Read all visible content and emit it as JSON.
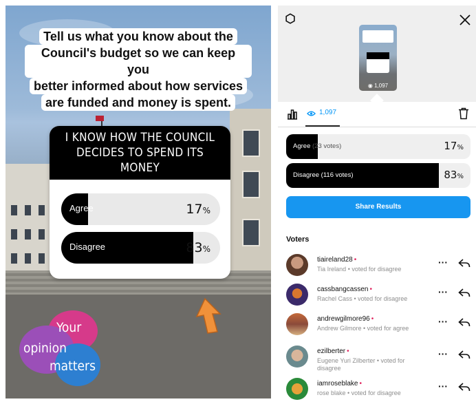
{
  "story": {
    "question_lines": [
      "Tell us what you know about the",
      "Council's budget so we can keep you",
      "better informed about how services",
      "are funded and money is spent."
    ],
    "poll": {
      "title": "I KNOW HOW THE COUNCIL DECIDES TO SPEND ITS MONEY",
      "options": [
        {
          "label": "Agree",
          "percent": "17",
          "sign": "%",
          "fill_fraction": 0.17
        },
        {
          "label": "Disagree",
          "percent": "83",
          "sign": "%",
          "fill_fraction": 0.83
        }
      ]
    },
    "logo": {
      "word1": "Your",
      "word2": "opinion",
      "word3": "matters"
    }
  },
  "results": {
    "thumbnail_views": "1,097",
    "tab_views_count": "1,097",
    "options": [
      {
        "label": "Agree",
        "votes": "(23 votes)",
        "percent": "17",
        "sign": "%",
        "fill_fraction": 0.17
      },
      {
        "label": "Disagree",
        "votes": "(116 votes)",
        "percent": "83",
        "sign": "%",
        "fill_fraction": 0.83
      }
    ],
    "share_label": "Share Results",
    "voters_heading": "Voters",
    "voters": [
      {
        "username": "tiaireland28",
        "subtitle": "Tia Ireland • voted for disagree"
      },
      {
        "username": "cassbangcassen",
        "subtitle": "Rachel Cass • voted for disagree"
      },
      {
        "username": "andrewgilmore96",
        "subtitle": "Andrew Gilmore • voted for agree"
      },
      {
        "username": "ezilberter",
        "subtitle": "Eugene Yuri Zilberter • voted for disagree"
      },
      {
        "username": "iamroseblake",
        "subtitle": "rose blake • voted for disagree"
      }
    ]
  },
  "colors": {
    "accent": "#1796f0",
    "bar_fill": "#000000",
    "bar_track": "#e9e9e9",
    "dot": "#e0245e"
  },
  "icons": [
    "settings-icon",
    "close-icon",
    "bar-chart-icon",
    "eye-icon",
    "trash-icon",
    "more-icon",
    "reply-icon",
    "arrow-up-icon"
  ]
}
